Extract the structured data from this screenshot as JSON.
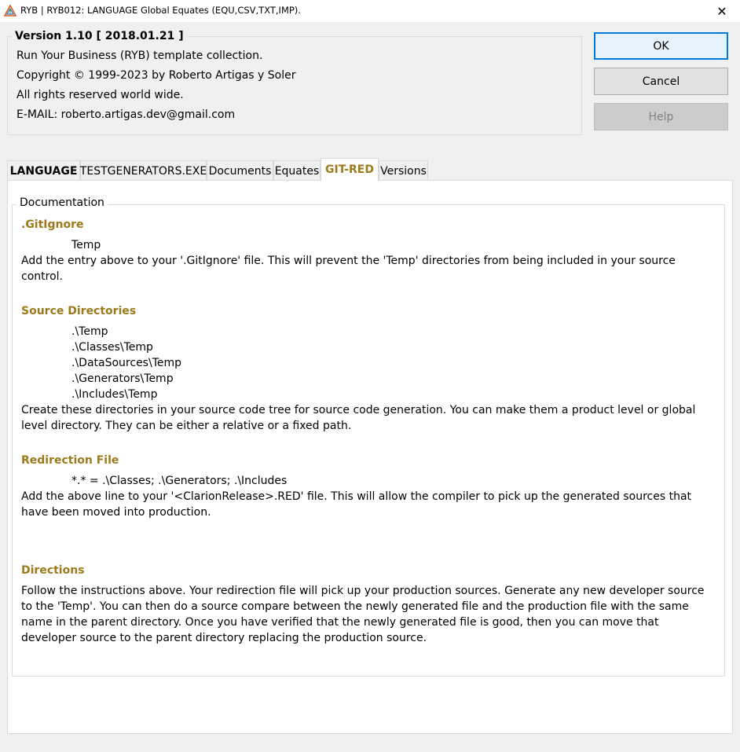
{
  "window": {
    "title": "RYB | RYB012: LANGUAGE Global Equates (EQU,CSV,TXT,IMP).",
    "close_glyph": "✕",
    "icon": "ryb-triangle-icon"
  },
  "about": {
    "version": "Version 1.10 [ 2018.01.21 ]",
    "lines": [
      "Run Your Business (RYB) template collection.",
      "Copyright © 1999-2023 by Roberto Artigas y Soler",
      "All rights reserved world wide.",
      "E-MAIL: roberto.artigas.dev@gmail.com"
    ]
  },
  "buttons": {
    "ok": "OK",
    "cancel": "Cancel",
    "help": "Help"
  },
  "tabs": [
    {
      "label": "LANGUAGE"
    },
    {
      "label": "TESTGENERATORS.EXE"
    },
    {
      "label": "Documents"
    },
    {
      "label": "Equates"
    },
    {
      "label": "GIT-RED",
      "active": true
    },
    {
      "label": "Versions"
    }
  ],
  "documentation": {
    "legend": "Documentation",
    "gitignore": {
      "heading": ".GitIgnore",
      "entry": "Temp",
      "text": "Add the entry above to your '.GitIgnore' file. This will prevent the 'Temp' directories from being included in your source control."
    },
    "source_dirs": {
      "heading": "Source Directories",
      "entries": [
        ".\\Temp",
        ".\\Classes\\Temp",
        ".\\DataSources\\Temp",
        ".\\Generators\\Temp",
        ".\\Includes\\Temp"
      ],
      "text": "Create these directories in your source code tree for source code generation. You can make them a product level or global level directory. They can be either a relative or a fixed path."
    },
    "redirection": {
      "heading": "Redirection File",
      "entry": "*.* = .\\Classes; .\\Generators; .\\Includes",
      "text": "Add the above line to your '<ClarionRelease>.RED' file. This will allow the compiler to pick up the generated sources that have been moved into production."
    },
    "directions": {
      "heading": "Directions",
      "text": "Follow the instructions above. Your redirection file will pick up your production sources. Generate any new developer source to the 'Temp'. You can then do a source compare between the newly generated file and the production file with the same name in the parent directory. Once you have verified that the newly generated file is good, then you can move that developer source to the parent directory replacing the production source."
    }
  }
}
